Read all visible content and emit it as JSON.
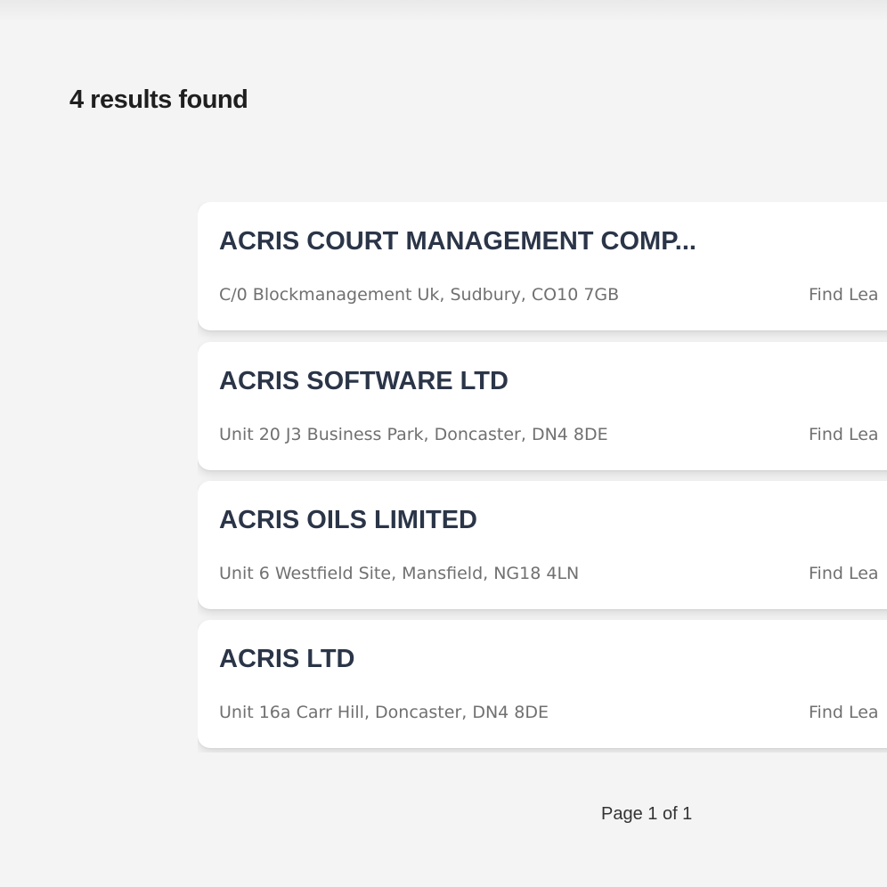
{
  "results_heading": "4 results found",
  "results": [
    {
      "name": "ACRIS COURT MANAGEMENT COMP...",
      "address": "C/0 Blockmanagement Uk, Sudbury, CO10 7GB",
      "link_label": "Find Lea"
    },
    {
      "name": "ACRIS SOFTWARE LTD",
      "address": "Unit 20 J3 Business Park, Doncaster, DN4 8DE",
      "link_label": "Find Lea"
    },
    {
      "name": "ACRIS OILS LIMITED",
      "address": "Unit 6 Westfield Site, Mansfield, NG18 4LN",
      "link_label": "Find Lea"
    },
    {
      "name": "ACRIS LTD",
      "address": "Unit 16a Carr Hill, Doncaster, DN4 8DE",
      "link_label": "Find Lea"
    }
  ],
  "pagination": {
    "label": "Page 1 of 1"
  },
  "colors": {
    "background": "#f4f4f4",
    "card": "#ffffff",
    "title": "#2b3548",
    "muted_text": "#707070"
  }
}
